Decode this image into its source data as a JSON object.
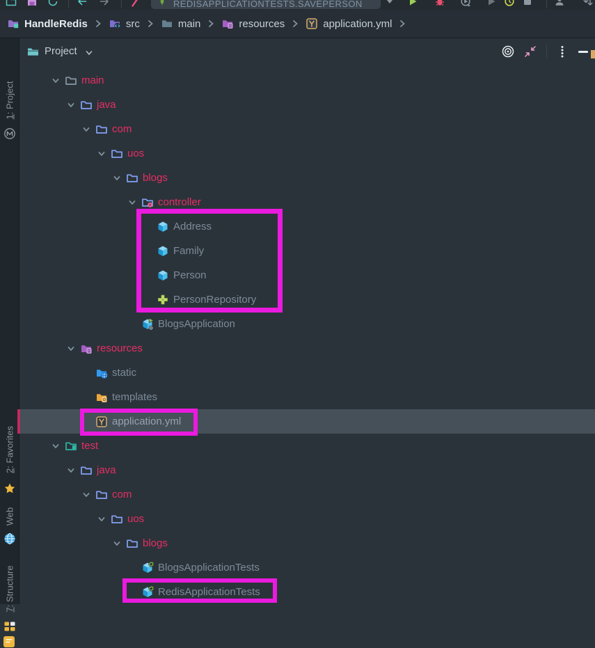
{
  "colors": {
    "panel_bg": "#2b333a",
    "toolbar_bg": "#242b31",
    "breadcrumb_bg": "#272e35",
    "sidebar_bg": "#1f262c",
    "selected_row": "#455059",
    "folder_text": "#e62e63",
    "file_text": "#7c8b99",
    "annotation": "#ea1adf",
    "selection_stripe": "#c22a5e"
  },
  "toolbar": {
    "run_config": "REDISAPPLICATIONTESTS.SAVEPERSON"
  },
  "breadcrumb": {
    "items": [
      {
        "label": "HandleRedis",
        "icon": "project-root"
      },
      {
        "label": "src",
        "icon": "src-root"
      },
      {
        "label": "main",
        "icon": "folder-gray"
      },
      {
        "label": "resources",
        "icon": "resources-root"
      },
      {
        "label": "application.yml",
        "icon": "yaml"
      }
    ]
  },
  "project_panel": {
    "title": "Project"
  },
  "sidebar": {
    "items": [
      {
        "id": "project",
        "mnemonic": "1",
        "label": ": Project",
        "icon": "maven"
      },
      {
        "id": "favorites",
        "mnemonic": "2",
        "label": ": Favorites",
        "icon": "star"
      },
      {
        "id": "web",
        "mnemonic": "",
        "label": "Web",
        "icon": "globe"
      },
      {
        "id": "structure",
        "mnemonic": "7",
        "label": ": Structure",
        "icon": "structure"
      }
    ]
  },
  "tree": {
    "items": [
      {
        "label": "main",
        "level": 0,
        "icon": "folder-main",
        "expandable": true,
        "accent": true,
        "selected": false
      },
      {
        "label": "java",
        "level": 1,
        "icon": "folder-blue",
        "expandable": true,
        "accent": true,
        "selected": false
      },
      {
        "label": "com",
        "level": 2,
        "icon": "folder-blue",
        "expandable": true,
        "accent": true,
        "selected": false
      },
      {
        "label": "uos",
        "level": 3,
        "icon": "folder-blue",
        "expandable": true,
        "accent": true,
        "selected": false
      },
      {
        "label": "blogs",
        "level": 4,
        "icon": "folder-blue",
        "expandable": true,
        "accent": true,
        "selected": false
      },
      {
        "label": "controller",
        "level": 5,
        "icon": "folder-controller",
        "expandable": true,
        "accent": true,
        "selected": false
      },
      {
        "label": "Address",
        "level": 6,
        "icon": "class",
        "expandable": false,
        "accent": false,
        "selected": false
      },
      {
        "label": "Family",
        "level": 6,
        "icon": "class",
        "expandable": false,
        "accent": false,
        "selected": false
      },
      {
        "label": "Person",
        "level": 6,
        "icon": "class",
        "expandable": false,
        "accent": false,
        "selected": false
      },
      {
        "label": "PersonRepository",
        "level": 6,
        "icon": "interface",
        "expandable": false,
        "accent": false,
        "selected": false
      },
      {
        "label": "BlogsApplication",
        "level": 5,
        "icon": "class-run",
        "expandable": false,
        "accent": false,
        "selected": false
      },
      {
        "label": "resources",
        "level": 1,
        "icon": "folder-resources",
        "expandable": true,
        "accent": true,
        "selected": false
      },
      {
        "label": "static",
        "level": 2,
        "icon": "folder-static",
        "expandable": false,
        "accent": false,
        "selected": false
      },
      {
        "label": "templates",
        "level": 2,
        "icon": "folder-templates",
        "expandable": false,
        "accent": false,
        "selected": false
      },
      {
        "label": "application.yml",
        "level": 2,
        "icon": "yaml",
        "expandable": false,
        "accent": false,
        "selected": true
      },
      {
        "label": "test",
        "level": 0,
        "icon": "folder-test",
        "expandable": true,
        "accent": true,
        "selected": false
      },
      {
        "label": "java",
        "level": 1,
        "icon": "folder-blue",
        "expandable": true,
        "accent": true,
        "selected": false
      },
      {
        "label": "com",
        "level": 2,
        "icon": "folder-blue",
        "expandable": true,
        "accent": true,
        "selected": false
      },
      {
        "label": "uos",
        "level": 3,
        "icon": "folder-blue",
        "expandable": true,
        "accent": true,
        "selected": false
      },
      {
        "label": "blogs",
        "level": 4,
        "icon": "folder-blue",
        "expandable": true,
        "accent": true,
        "selected": false
      },
      {
        "label": "BlogsApplicationTests",
        "level": 5,
        "icon": "class-test",
        "expandable": false,
        "accent": false,
        "selected": false
      },
      {
        "label": "RedisApplicationTests",
        "level": 5,
        "icon": "class-test",
        "expandable": false,
        "accent": false,
        "selected": false
      }
    ]
  },
  "annotations": {
    "boxes": [
      {
        "target": "controller-classes"
      },
      {
        "target": "application-yml-row"
      },
      {
        "target": "redis-application-tests-row"
      }
    ]
  }
}
